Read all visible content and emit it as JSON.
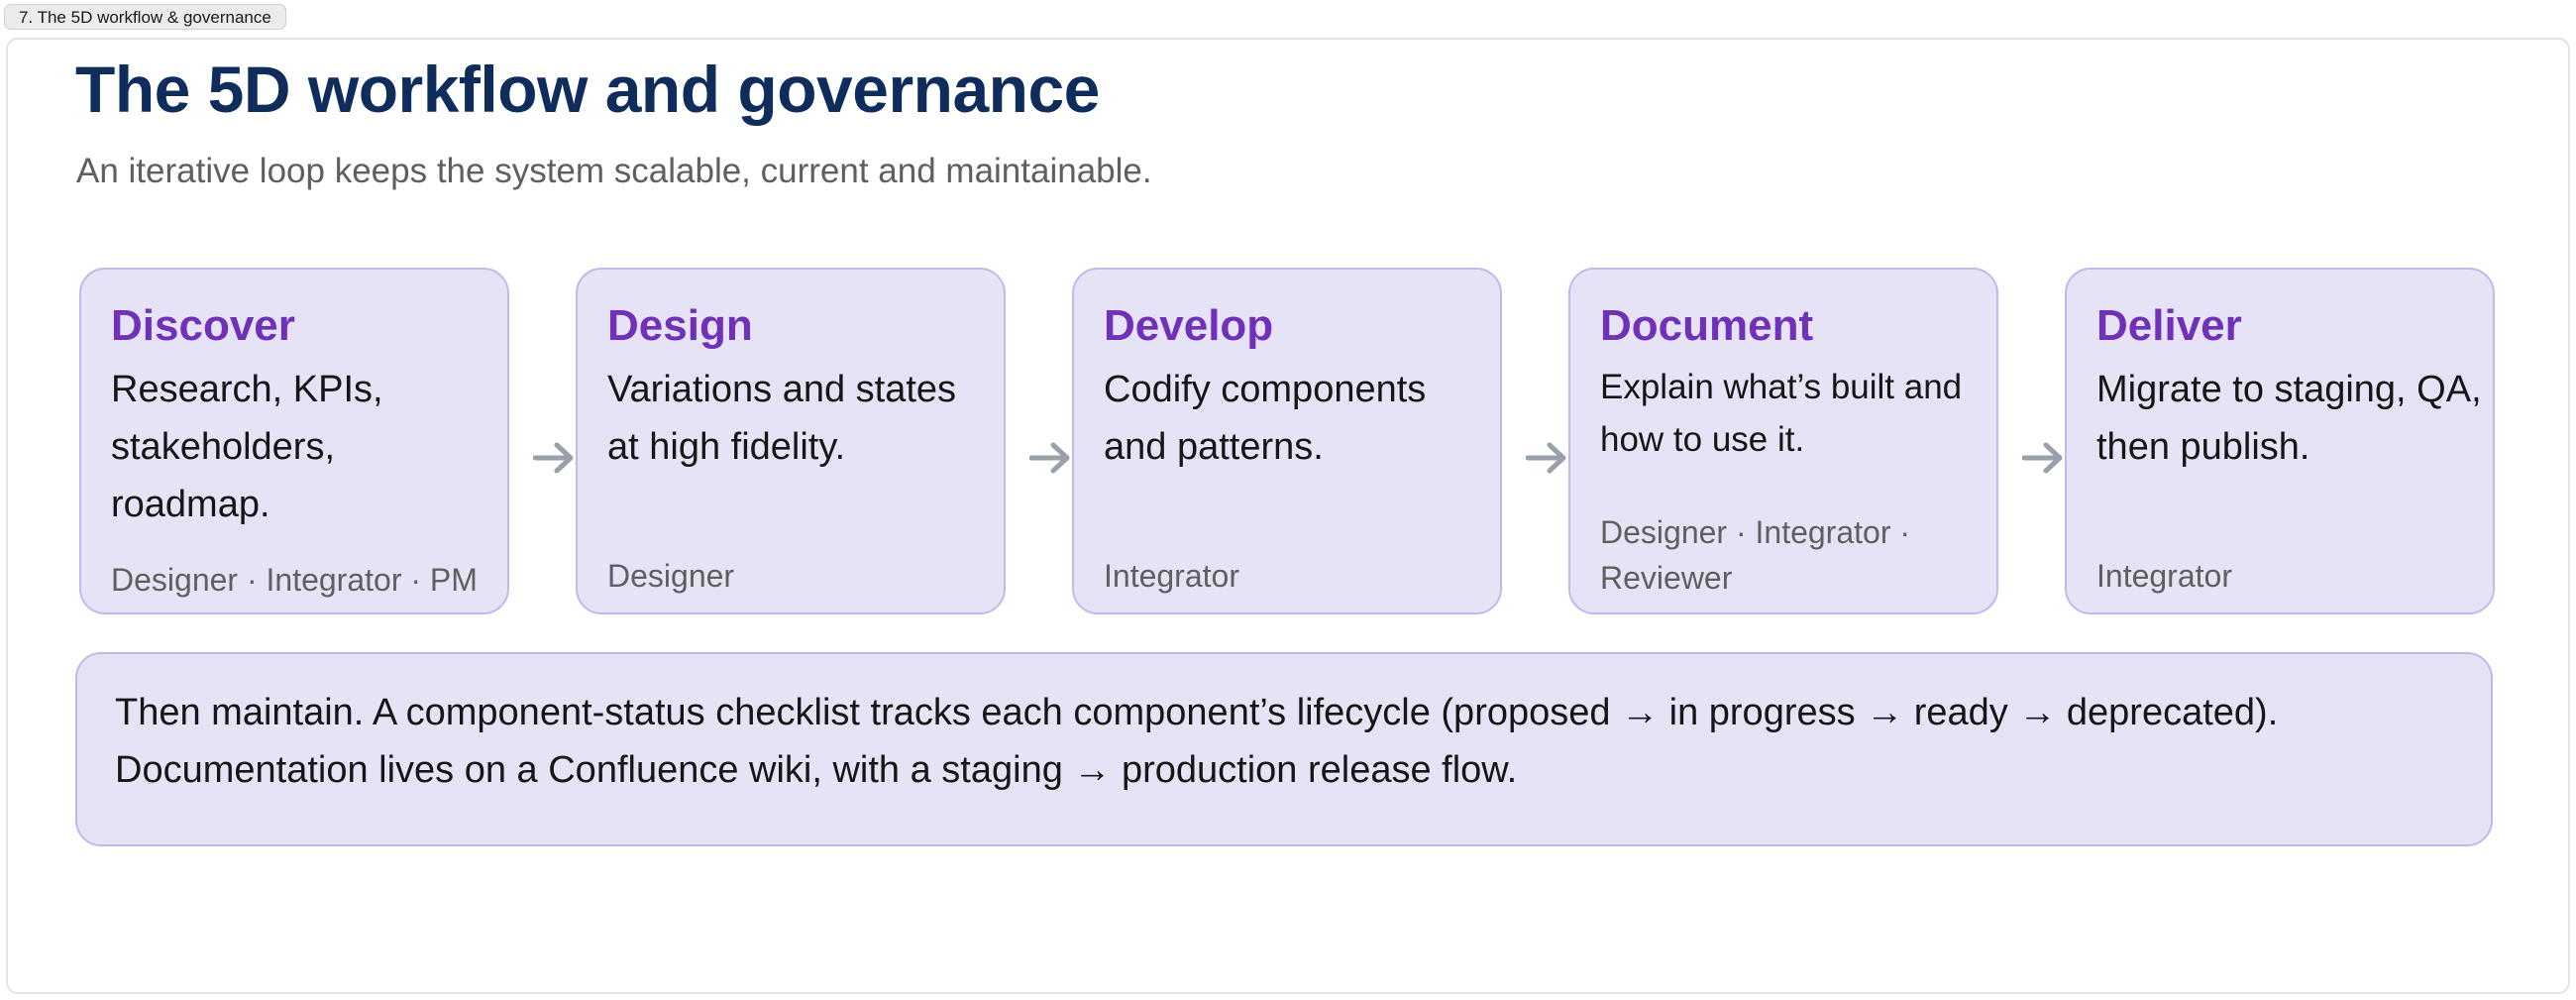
{
  "tab": {
    "label": "7. The 5D workflow & governance"
  },
  "slide": {
    "title": "The 5D workflow and governance",
    "subtitle": "An iterative loop keeps the system scalable, current and maintainable."
  },
  "steps": [
    {
      "title": "Discover",
      "description": "Research, KPIs, stakeholders, roadmap.",
      "roles": "Designer · Integrator · PM"
    },
    {
      "title": "Design",
      "description": "Variations and states at high fidelity.",
      "roles": "Designer"
    },
    {
      "title": "Develop",
      "description": "Codify components and patterns.",
      "roles": "Integrator"
    },
    {
      "title": "Document",
      "description": "Explain what’s built and how to use it.",
      "roles": "Designer · Integrator · Reviewer"
    },
    {
      "title": "Deliver",
      "description": "Migrate to staging, QA, then publish.",
      "roles": "Integrator"
    }
  ],
  "arrow_icon": "arrow-right-icon",
  "colors": {
    "title": "#0f2d5c",
    "step_title": "#7030b8",
    "card_background": "#e7e3f7",
    "card_border": "#c2b8ea",
    "arrow": "#9aa0aa"
  },
  "maintain_note": {
    "line1": "Then maintain. A component-status checklist tracks each component’s lifecycle (proposed → in progress → ready → deprecated).",
    "line2": "Documentation lives on a Confluence wiki, with a staging → production release flow."
  }
}
